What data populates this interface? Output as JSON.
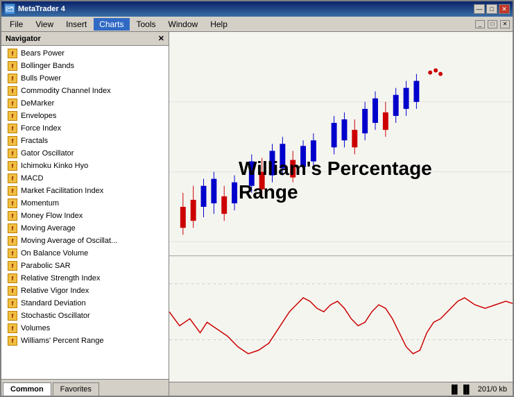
{
  "window": {
    "title": "MetaTrader 4",
    "icon": "chart-icon"
  },
  "menu": {
    "items": [
      "File",
      "View",
      "Insert",
      "Charts",
      "Tools",
      "Window",
      "Help"
    ],
    "active": "Charts"
  },
  "navigator": {
    "title": "Navigator",
    "items": [
      "Bears Power",
      "Bollinger Bands",
      "Bulls Power",
      "Commodity Channel Index",
      "DeMarker",
      "Envelopes",
      "Force Index",
      "Fractals",
      "Gator Oscillator",
      "Ichimoku Kinko Hyo",
      "MACD",
      "Market Facilitation Index",
      "Momentum",
      "Money Flow Index",
      "Moving Average",
      "Moving Average of Oscillat...",
      "On Balance Volume",
      "Parabolic SAR",
      "Relative Strength Index",
      "Relative Vigor Index",
      "Standard Deviation",
      "Stochastic Oscillator",
      "Volumes",
      "Williams' Percent Range"
    ]
  },
  "chart": {
    "label_line1": "William's Percentage",
    "label_line2": "Range"
  },
  "tabs": {
    "items": [
      "Common",
      "Favorites"
    ]
  },
  "statusbar": {
    "text": "201/0 kb",
    "icon": "bars-icon"
  },
  "title_buttons": {
    "minimize": "—",
    "maximize": "□",
    "close": "✕"
  },
  "inner_buttons": {
    "minimize": "_",
    "maximize": "□",
    "close": "✕"
  }
}
